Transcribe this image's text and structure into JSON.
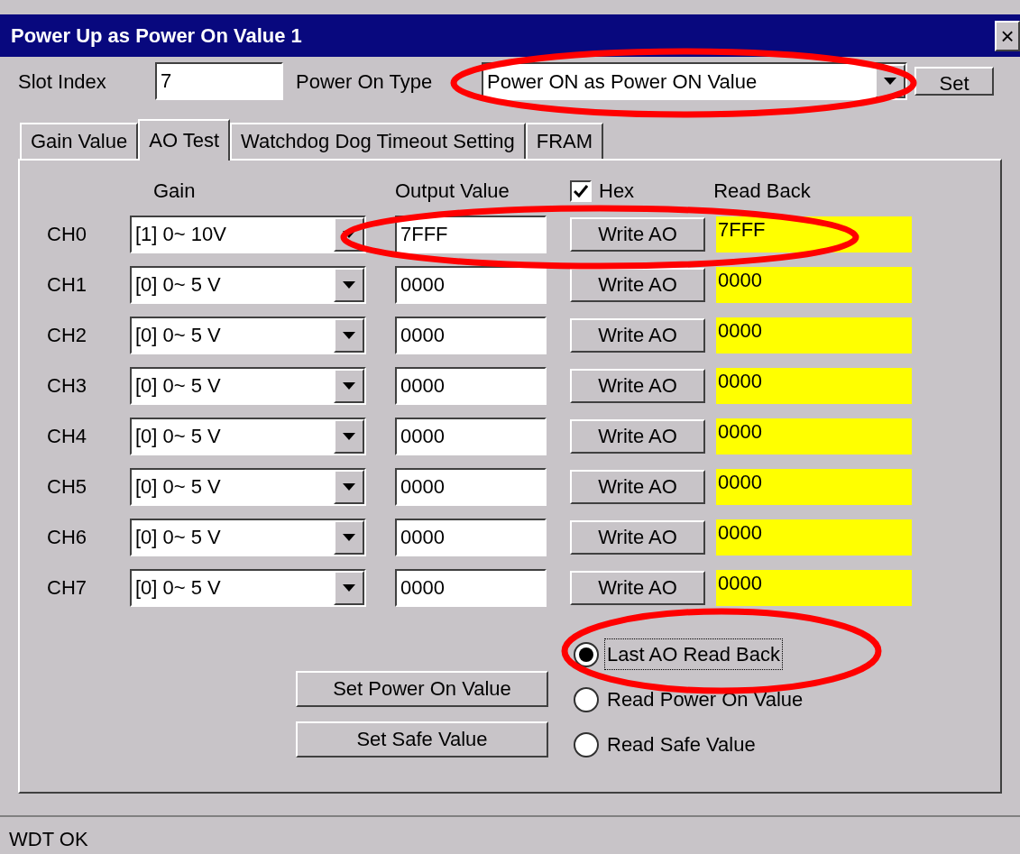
{
  "window": {
    "title": "Power Up as Power On Value 1",
    "close": "×"
  },
  "slot_index": {
    "label": "Slot Index",
    "value": "7"
  },
  "power_on_type": {
    "label": "Power On Type",
    "value": "Power ON as Power ON Value"
  },
  "set_button": "Set",
  "tabs": [
    {
      "label": "Gain Value",
      "selected": false
    },
    {
      "label": "AO Test",
      "selected": true
    },
    {
      "label": "Watchdog Dog Timeout Setting",
      "selected": false
    },
    {
      "label": "FRAM",
      "selected": false
    }
  ],
  "headers": {
    "gain": "Gain",
    "output": "Output Value",
    "hex": {
      "label": "Hex",
      "checked": true
    },
    "read_back": "Read Back"
  },
  "channels": [
    {
      "name": "CH0",
      "gain": "[1] 0~ 10V",
      "output": "7FFF",
      "button": "Write AO",
      "read_back": "7FFF"
    },
    {
      "name": "CH1",
      "gain": "[0] 0~ 5 V",
      "output": "0000",
      "button": "Write AO",
      "read_back": "0000"
    },
    {
      "name": "CH2",
      "gain": "[0] 0~ 5 V",
      "output": "0000",
      "button": "Write AO",
      "read_back": "0000"
    },
    {
      "name": "CH3",
      "gain": "[0] 0~ 5 V",
      "output": "0000",
      "button": "Write AO",
      "read_back": "0000"
    },
    {
      "name": "CH4",
      "gain": "[0] 0~ 5 V",
      "output": "0000",
      "button": "Write AO",
      "read_back": "0000"
    },
    {
      "name": "CH5",
      "gain": "[0] 0~ 5 V",
      "output": "0000",
      "button": "Write AO",
      "read_back": "0000"
    },
    {
      "name": "CH6",
      "gain": "[0] 0~ 5 V",
      "output": "0000",
      "button": "Write AO",
      "read_back": "0000"
    },
    {
      "name": "CH7",
      "gain": "[0] 0~ 5 V",
      "output": "0000",
      "button": "Write AO",
      "read_back": "0000"
    }
  ],
  "action_buttons": [
    "Set Power On Value",
    "Set Safe Value"
  ],
  "read_options": [
    {
      "label": "Last AO Read Back",
      "selected": true
    },
    {
      "label": "Read Power On Value",
      "selected": false
    },
    {
      "label": "Read Safe Value",
      "selected": false
    }
  ],
  "status_bar": "WDT OK"
}
